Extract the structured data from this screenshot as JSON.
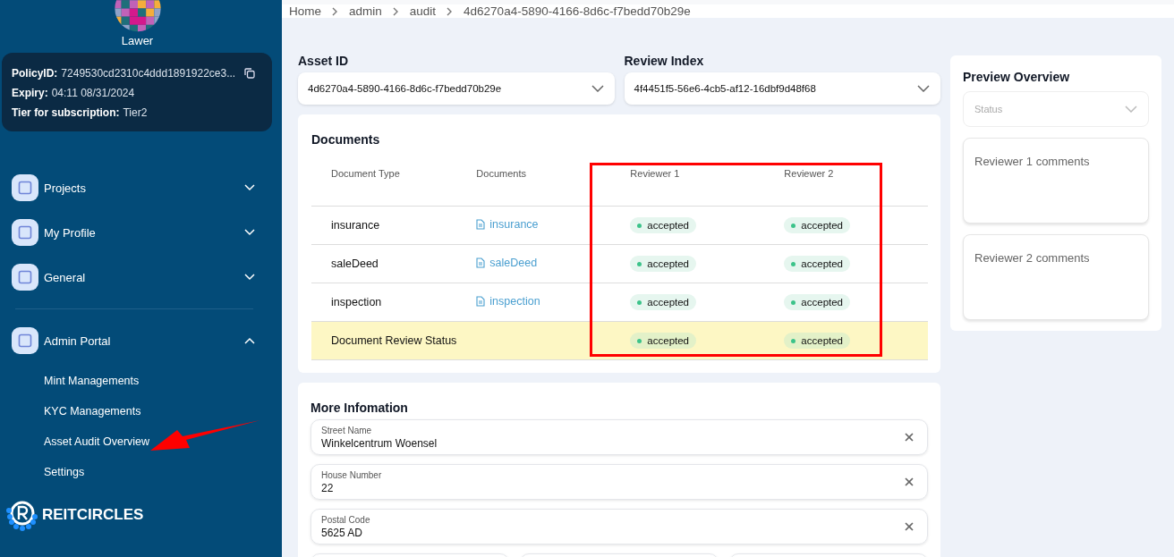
{
  "sidebar": {
    "user_name": "Lawer",
    "policy_card": {
      "rows": [
        {
          "label": "PolicyID:",
          "value": "7249530cd2310c4ddd1891922ce3...",
          "copyable": true
        },
        {
          "label": "Expiry:",
          "value": "04:11 08/31/2024",
          "copyable": false
        },
        {
          "label": "Tier for subscription:",
          "value": "Tier2",
          "copyable": false
        }
      ]
    },
    "nav": [
      {
        "label": "Projects",
        "expanded": false
      },
      {
        "label": "My Profile",
        "expanded": false
      },
      {
        "label": "General",
        "expanded": false
      },
      {
        "label": "Admin Portal",
        "expanded": true,
        "children": [
          {
            "label": "Mint Managements"
          },
          {
            "label": "KYC Managements"
          },
          {
            "label": "Asset Audit Overview"
          },
          {
            "label": "Settings"
          }
        ]
      }
    ],
    "brand": "REITCIRCLES"
  },
  "breadcrumb": [
    "Home",
    "admin",
    "audit",
    "4d6270a4-5890-4166-8d6c-f7bedd70b29e"
  ],
  "selects": [
    {
      "label": "Asset ID",
      "value": "4d6270a4-5890-4166-8d6c-f7bedd70b29e"
    },
    {
      "label": "Review Index",
      "value": "4f4451f5-56e6-4cb5-af12-16dbf9d48f68"
    }
  ],
  "documents": {
    "title": "Documents",
    "columns": [
      "Document Type",
      "Documents",
      "Reviewer 1",
      "Reviewer 2"
    ],
    "rows": [
      {
        "kind": "document",
        "type": "insurance",
        "document": "insurance",
        "reviewer_1": "accepted",
        "reviewer_2": "accepted"
      },
      {
        "kind": "document",
        "type": "saleDeed",
        "document": "saleDeed",
        "reviewer_1": "accepted",
        "reviewer_2": "accepted"
      },
      {
        "kind": "document",
        "type": "inspection",
        "document": "inspection",
        "reviewer_1": "accepted",
        "reviewer_2": "accepted"
      },
      {
        "kind": "summary",
        "type": "Document Review Status",
        "reviewer_1": "accepted",
        "reviewer_2": "accepted"
      }
    ]
  },
  "more_information": {
    "title": "More Infomation",
    "fields": [
      {
        "label": "Street Name",
        "value": "Winkelcentrum Woensel"
      },
      {
        "label": "House Number",
        "value": "22"
      },
      {
        "label": "Postal Code",
        "value": "5625 AD"
      }
    ]
  },
  "preview": {
    "title": "Preview Overview",
    "status_placeholder": "Status",
    "comments": [
      {
        "placeholder": "Reviewer 1 comments"
      },
      {
        "placeholder": "Reviewer 2 comments"
      }
    ]
  }
}
